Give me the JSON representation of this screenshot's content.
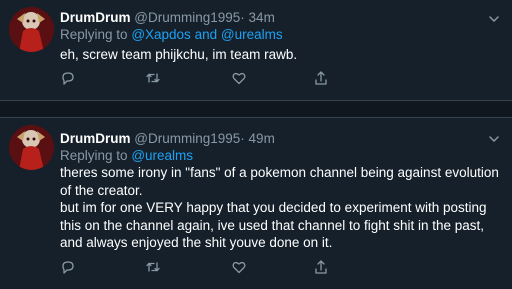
{
  "tweets": [
    {
      "display_name": "DrumDrum",
      "handle": "@Drumming1995",
      "separator": "·",
      "time": "34m",
      "replying_prefix": "Replying to",
      "replying_to": [
        "@Xapdos",
        "@urealms"
      ],
      "replying_joiner": "and",
      "text": [
        "eh, screw team phijkchu, im team rawb."
      ],
      "icons": [
        "avatar",
        "chevron-down-icon",
        "reply-icon",
        "retweet-icon",
        "like-icon",
        "share-icon"
      ]
    },
    {
      "display_name": "DrumDrum",
      "handle": "@Drumming1995",
      "separator": "·",
      "time": "49m",
      "replying_prefix": "Replying to",
      "replying_to": [
        "@urealms"
      ],
      "text": [
        "theres some irony in \"fans\" of a pokemon channel being against evolution of the creator.",
        "but im for one VERY happy that you decided to experiment with posting this on the channel again, ive used that channel to fight shit in the past, and always enjoyed the shit youve done on it."
      ],
      "icons": [
        "avatar",
        "chevron-down-icon",
        "reply-icon",
        "retweet-icon",
        "like-icon",
        "share-icon"
      ]
    }
  ],
  "colors": {
    "background": "#15202b",
    "divider": "#38444d",
    "gap": "#10171e",
    "secondary_text": "#8899a6",
    "mention": "#1da1f2",
    "primary_text": "#ffffff"
  }
}
